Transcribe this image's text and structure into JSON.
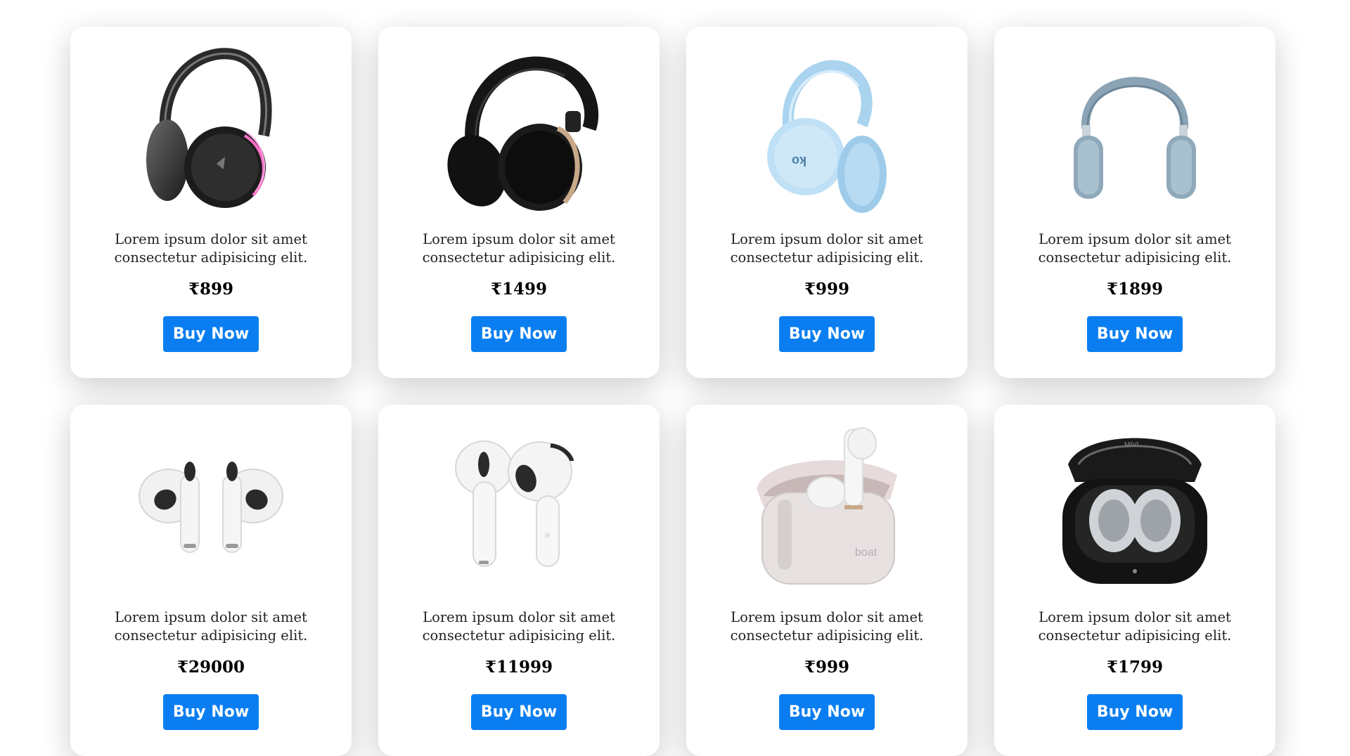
{
  "products": [
    {
      "description": "Lorem ipsum dolor sit amet consectetur adipisicing elit.",
      "price": "₹899",
      "button_label": "Buy Now",
      "image": "headphones-black-rgb"
    },
    {
      "description": "Lorem ipsum dolor sit amet consectetur adipisicing elit.",
      "price": "₹1499",
      "button_label": "Buy Now",
      "image": "headphones-black-gold"
    },
    {
      "description": "Lorem ipsum dolor sit amet consectetur adipisicing elit.",
      "price": "₹999",
      "button_label": "Buy Now",
      "image": "headphones-light-blue"
    },
    {
      "description": "Lorem ipsum dolor sit amet consectetur adipisicing elit.",
      "price": "₹1899",
      "button_label": "Buy Now",
      "image": "headphones-sky-blue"
    },
    {
      "description": "Lorem ipsum dolor sit amet consectetur adipisicing elit.",
      "price": "₹29000",
      "button_label": "Buy Now",
      "image": "earbuds-white-pro"
    },
    {
      "description": "Lorem ipsum dolor sit amet consectetur adipisicing elit.",
      "price": "₹11999",
      "button_label": "Buy Now",
      "image": "earbuds-white"
    },
    {
      "description": "Lorem ipsum dolor sit amet consectetur adipisicing elit.",
      "price": "₹999",
      "button_label": "Buy Now",
      "image": "earbuds-case-pearl"
    },
    {
      "description": "Lorem ipsum dolor sit amet consectetur adipisicing elit.",
      "price": "₹1799",
      "button_label": "Buy Now",
      "image": "earbuds-case-black"
    }
  ],
  "case_brand_text": "boat",
  "case_logo_text": "MIVI",
  "colors": {
    "button": "#0a7ef0",
    "button_text": "#ffffff"
  }
}
